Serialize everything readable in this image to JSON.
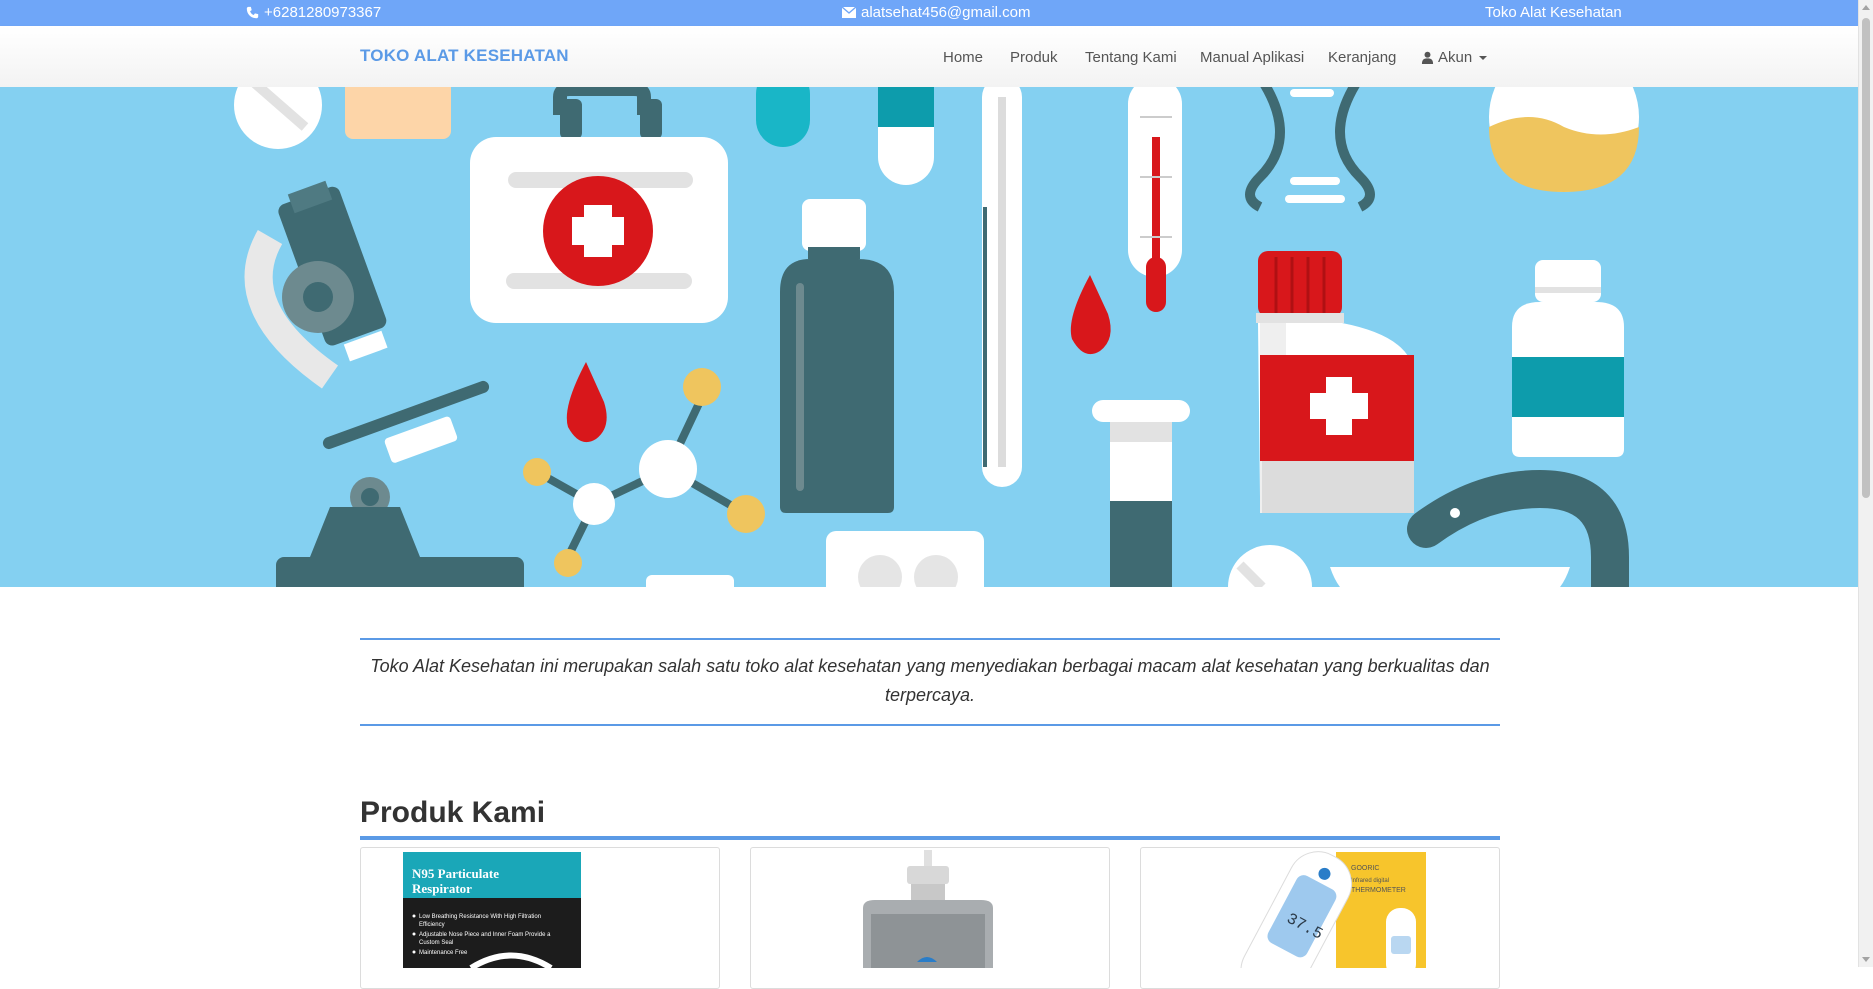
{
  "topbar": {
    "phone": "+6281280973367",
    "email": "alatsehat456@gmail.com",
    "brand": "Toko Alat Kesehatan"
  },
  "navbar": {
    "logo": "TOKO ALAT KESEHATAN",
    "menu": [
      "Home",
      "Produk",
      "Tentang Kami",
      "Manual Aplikasi",
      "Keranjang"
    ],
    "account": "Akun"
  },
  "intro": {
    "text": "Toko Alat Kesehatan ini merupakan salah satu toko alat kesehatan yang menyediakan berbagai macam alat kesehatan yang berkualitas dan terpercaya."
  },
  "products": {
    "title": "Produk Kami",
    "items": [
      {
        "box_title": "N95 Particulate Respirator",
        "bullets": [
          "Low Breathing Resistance With High Filtration Efficiency",
          "Adjustable Nose Piece and Inner Foam Provide a Custom Seal",
          "Maintenance Free"
        ]
      },
      {
        "label": ""
      },
      {
        "brand": "GOORIC",
        "box_text": "Infrared digital THERMOMETER",
        "reading": "37.5"
      }
    ]
  },
  "colors": {
    "topbar": "#6fa6f8",
    "accent": "#5b9ae6",
    "hero_bg": "#84d0f1",
    "red": "#d8171b",
    "teal_dark": "#3f6a72"
  }
}
